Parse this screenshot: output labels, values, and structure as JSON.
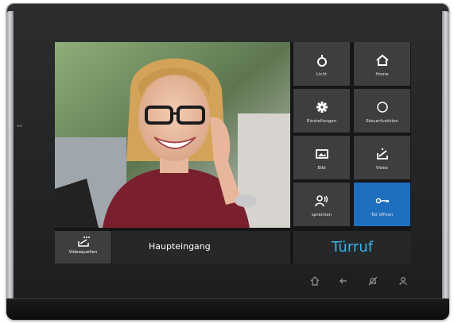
{
  "tiles": {
    "licht": "Licht",
    "home": "Home",
    "einstellungen": "Einstellungen",
    "steuerfunktion": "Steuerfunktion",
    "bild": "Bild",
    "video": "Video",
    "sprechen": "sprechen",
    "tuer_oeffnen": "Tür öffnen"
  },
  "bottom": {
    "videoquellen": "Videoquellen",
    "entrance_label": "Haupteingang",
    "call_label": "Türruf"
  },
  "colors": {
    "active_tile": "#1f6fc0",
    "call_text": "#38b3e6"
  },
  "hardware_icons": [
    "home-icon",
    "back-arrow-icon",
    "bell-mute-icon",
    "person-icon"
  ]
}
